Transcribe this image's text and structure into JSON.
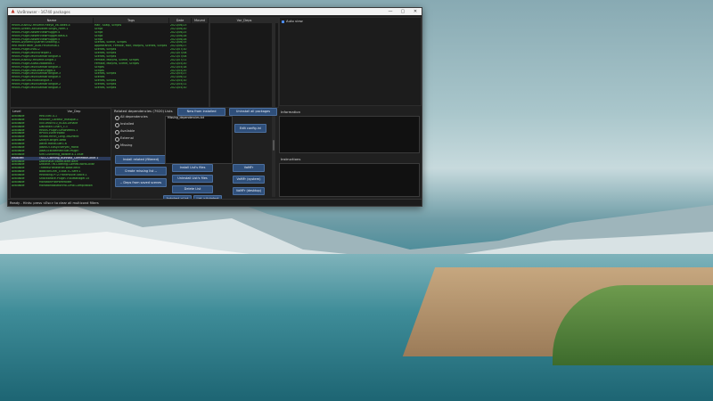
{
  "window": {
    "title": "VarBrowser - 16740 packages",
    "minimize": "—",
    "maximize": "▢",
    "close": "✕"
  },
  "packages": {
    "columns": [
      "Name",
      "Tags",
      "Date",
      "Moved"
    ],
    "rows": [
      [
        "Hhkks.custt42.Hhuehe.Hexya_Va.Takex.4",
        "Hair, Scalp, Scripts",
        "2021/06/23",
        ""
      ],
      [
        "Hhkks.GreenCalcSauditer.Singis_Farm.1",
        "Script",
        "2021/06/20",
        ""
      ],
      [
        "Hhkks.Plugin.NewerViewPlugger.4",
        "Script",
        "2021/06/25",
        ""
      ],
      [
        "Hhkks.Plugin.NewerViewPlugger.Beta.4",
        "Script",
        "2021/06/28",
        ""
      ],
      [
        "Hhkks.Plugin.NewerViewPlugger.5",
        "Script",
        "2021/06/28",
        ""
      ],
      [
        "Hhkks.DynamicQuarter.Shading.1",
        "Scenes, Scene, Scripts",
        "2021/06/15",
        ""
      ],
      [
        "HhkTraverTeller_Audi.Hhuhuhua.1",
        "Appearance, Female, Hair, Morphs, Scenes, Scripts",
        "2021/06/27",
        ""
      ],
      [
        "Hhkks.Plugin.Indu.2",
        "Scenes, Scripts",
        "2021/07/10",
        ""
      ],
      [
        "Hhkks.Plugin.MultiSHelper.1",
        "Scenes, Scripts",
        "2021/07/08",
        ""
      ],
      [
        "Hhkks.Plugin.MultiSelfbarTongue.4",
        "Scenes, Scripts",
        "2021/07/08",
        ""
      ],
      [
        "Hhkks.custt42.Hhuehe.Single.1",
        "Female, Morphs, Scene, Scripts",
        "2021/07/11",
        ""
      ],
      [
        "Hhkks.Plugin.AliasGrabbedit.1",
        "Female, Morphs, Scene, Scripts",
        "2021/05/20",
        ""
      ],
      [
        "Hhkks.Plugin.MultiSelfbarTongue.1",
        "Scripts",
        "2021/05/18",
        ""
      ],
      [
        "Hhkks.Plugin.HesumerOrggit.4",
        "Scripts",
        "2021/05/20",
        ""
      ],
      [
        "Hhkks.Plugin.MultiSelfbarTongue.3",
        "Scenes, Scripts",
        "2021/05/27",
        ""
      ],
      [
        "Hhkks.Plugin.MultiSelfbarTongue.5",
        "Scenes",
        "2021/06/12",
        ""
      ],
      [
        "Hhkks.Tortura.MultiTongue.1",
        "Scenes, Scripts",
        "2021/05/10",
        ""
      ],
      [
        "Hhkks.Plugin.MultiSelfbarTongue.2",
        "Scenes, Scripts",
        "2021/05/11",
        ""
      ],
      [
        "Hhkks.Plugin.MultiSelfbarTongue.3",
        "Scenes, Scripts",
        "2021/05/10",
        ""
      ]
    ]
  },
  "varDeps": {
    "header": "Var_Deps"
  },
  "autoView": {
    "label": "Auto view"
  },
  "dependencies": {
    "columns": [
      "Level",
      "Var_Dep"
    ],
    "rows": [
      [
        "Available",
        "Hhk.Elec.4.1"
      ],
      [
        "Available",
        "Hhk06ff_Cocteur_masque.1"
      ],
      [
        "Available",
        "0001RBE910_KGxA.Lenace"
      ],
      [
        "Available",
        "Dalcarain.Chart_3.3"
      ],
      [
        "Available",
        "Hhkks.Plugin.SimonMenu.1"
      ],
      [
        "Available",
        "RP0001Sherinbab"
      ],
      [
        "Available",
        "Shiato.Hhhh_Long.3RDPaint"
      ],
      [
        "Available",
        "Diceyh.Bright.Beta"
      ],
      [
        "Available",
        "Jaeve.HandGuer1.6"
      ],
      [
        "Available",
        "Jose40T.Easy.Everyeli_Hand"
      ],
      [
        "Available",
        "Jose0.Excitementfuel.Plugin"
      ],
      [
        "Available",
        "Kirk.Cluttering_Bolster.4.1.Elue"
      ],
      [
        "Installed",
        "TSCC.Clothing_Bunhalo_ComedBoCollar.1"
      ],
      [
        "Available",
        "Dbitchaue.Sweet.Beer.aere"
      ],
      [
        "Available",
        "Ddcave.TW.Clothing.Comed.BoraCollar"
      ],
      [
        "Available",
        "TheeHuHedelenet.Base.kelvi"
      ],
      [
        "Available",
        "BobElanChel_0.alia.TC.Sere.1"
      ],
      [
        "Available",
        "Hhkkbing.PTZ.FrontPAulie.Stock.1"
      ],
      [
        "Available",
        "ShackBrace.Plugin.ThAlManager.15"
      ],
      [
        "Available",
        "MonotonPlotPortMolkel"
      ],
      [
        "Available",
        "MonotonaButtonHo.Limb.Compilation"
      ]
    ]
  },
  "related": {
    "title": "Related dependencies (7920)",
    "options": [
      "All dependencies",
      "Installed",
      "Available",
      "External",
      "Missing"
    ],
    "install_filtered": "Install related (filtered)",
    "create_missing": "Create missing list --",
    "deps_from_scenes": "--  Deps from saved scenes"
  },
  "lists": {
    "label": "Lists",
    "new_from_installed": "New from installed",
    "uninstall_all": "Uninstall all packages",
    "selected_item": "Missing_dependencies.txt",
    "edit_config": "Edit config.ini",
    "install_lists": "Install List's files",
    "uninstall_lists": "Uninstall List's files",
    "delete_list": "Delete List",
    "autoinst_to_list": "AutoInst->List",
    "list_to_autoinst": "List->AutoInst",
    "varfr": "VaMFr",
    "varfr_system": "VaMFr (system)",
    "varfr_desktop": "VaMFr (desktop)"
  },
  "info": {
    "information": "Information",
    "instructions": "Instructions"
  },
  "status": {
    "text": "Ready - Hints: press <Esc> to clear all multicond filters"
  }
}
